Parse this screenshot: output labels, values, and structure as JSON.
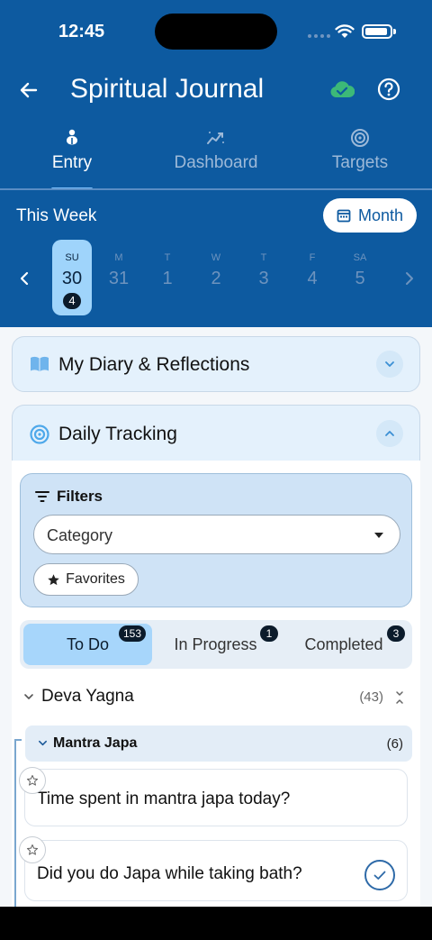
{
  "status": {
    "time": "12:45"
  },
  "header": {
    "title": "Spiritual Journal",
    "colors": {
      "bar": "#0d5aa0",
      "cloud": "#3cb878"
    }
  },
  "tabs": [
    {
      "label": "Entry",
      "icon": "lotus-icon",
      "active": true
    },
    {
      "label": "Dashboard",
      "icon": "chart-icon",
      "active": false
    },
    {
      "label": "Targets",
      "icon": "target-icon",
      "active": false
    }
  ],
  "week": {
    "label": "This Week",
    "month_button": "Month",
    "days": [
      {
        "dow": "SU",
        "num": "30",
        "badge": "4",
        "selected": true
      },
      {
        "dow": "M",
        "num": "31"
      },
      {
        "dow": "T",
        "num": "1"
      },
      {
        "dow": "W",
        "num": "2"
      },
      {
        "dow": "T",
        "num": "3"
      },
      {
        "dow": "F",
        "num": "4"
      },
      {
        "dow": "SA",
        "num": "5"
      }
    ]
  },
  "sections": {
    "diary": {
      "title": "My Diary & Reflections",
      "icon": "book-icon",
      "expanded": false
    },
    "tracking": {
      "title": "Daily Tracking",
      "icon": "target-icon",
      "expanded": true
    }
  },
  "filters": {
    "title": "Filters",
    "category_placeholder": "Category",
    "favorites_label": "Favorites"
  },
  "segments": [
    {
      "label": "To Do",
      "count": "153",
      "active": true
    },
    {
      "label": "In Progress",
      "count": "1",
      "active": false
    },
    {
      "label": "Completed",
      "count": "3",
      "active": false
    }
  ],
  "group": {
    "title": "Deva Yagna",
    "count": "(43)"
  },
  "subgroup": {
    "title": "Mantra Japa",
    "count": "(6)"
  },
  "questions": [
    {
      "text": "Time spent in mantra japa today?"
    },
    {
      "text": "Did you do Japa while taking bath?"
    }
  ]
}
